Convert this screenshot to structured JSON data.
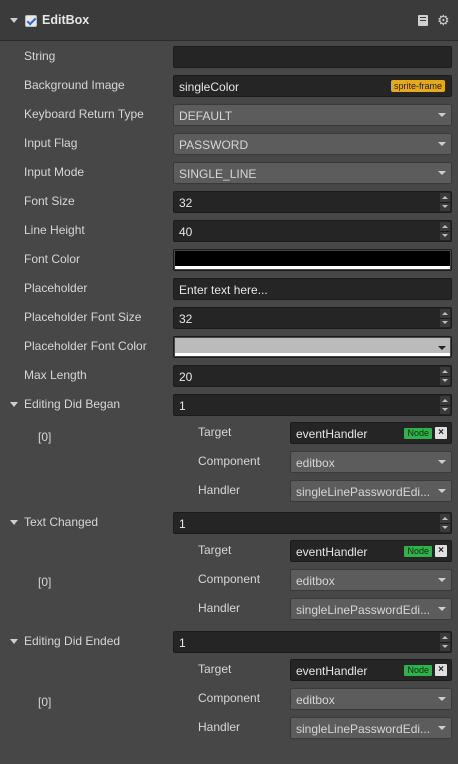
{
  "header": {
    "title": "EditBox",
    "enabled": true,
    "icons": [
      "collapse-arrow-icon",
      "checkbox-icon",
      "book-icon",
      "gear-icon"
    ]
  },
  "props": {
    "string": {
      "label": "String",
      "value": ""
    },
    "background_image": {
      "label": "Background Image",
      "value": "singleColor",
      "tag": "sprite-frame"
    },
    "keyboard_return_type": {
      "label": "Keyboard Return Type",
      "value": "DEFAULT"
    },
    "input_flag": {
      "label": "Input Flag",
      "value": "PASSWORD"
    },
    "input_mode": {
      "label": "Input Mode",
      "value": "SINGLE_LINE"
    },
    "font_size": {
      "label": "Font Size",
      "value": "32"
    },
    "line_height": {
      "label": "Line Height",
      "value": "40"
    },
    "font_color": {
      "label": "Font Color",
      "value": "#000000"
    },
    "placeholder": {
      "label": "Placeholder",
      "value": "Enter text here..."
    },
    "placeholder_font_size": {
      "label": "Placeholder Font Size",
      "value": "32"
    },
    "placeholder_font_color": {
      "label": "Placeholder Font Color",
      "value": "#bbbbbb"
    },
    "max_length": {
      "label": "Max Length",
      "value": "20"
    }
  },
  "events": [
    {
      "label": "Editing Did Began",
      "count": "1",
      "index": "[0]",
      "target_label": "Target",
      "target": "eventHandler",
      "target_tag": "Node",
      "component_label": "Component",
      "component": "editbox",
      "handler_label": "Handler",
      "handler": "singleLinePasswordEdi..."
    },
    {
      "label": "Text Changed",
      "count": "1",
      "index": "[0]",
      "target_label": "Target",
      "target": "eventHandler",
      "target_tag": "Node",
      "component_label": "Component",
      "component": "editbox",
      "handler_label": "Handler",
      "handler": "singleLinePasswordEdi..."
    },
    {
      "label": "Editing Did Ended",
      "count": "1",
      "index": "[0]",
      "target_label": "Target",
      "target": "eventHandler",
      "target_tag": "Node",
      "component_label": "Component",
      "component": "editbox",
      "handler_label": "Handler",
      "handler": "singleLinePasswordEdi..."
    }
  ],
  "colors": {
    "panel_bg": "#474747",
    "header_bg": "#3b3b3b",
    "field_bg": "#252525",
    "select_bg": "#5c5c5c",
    "sprite_tag": "#e6a91a",
    "node_tag": "#2db34a"
  }
}
